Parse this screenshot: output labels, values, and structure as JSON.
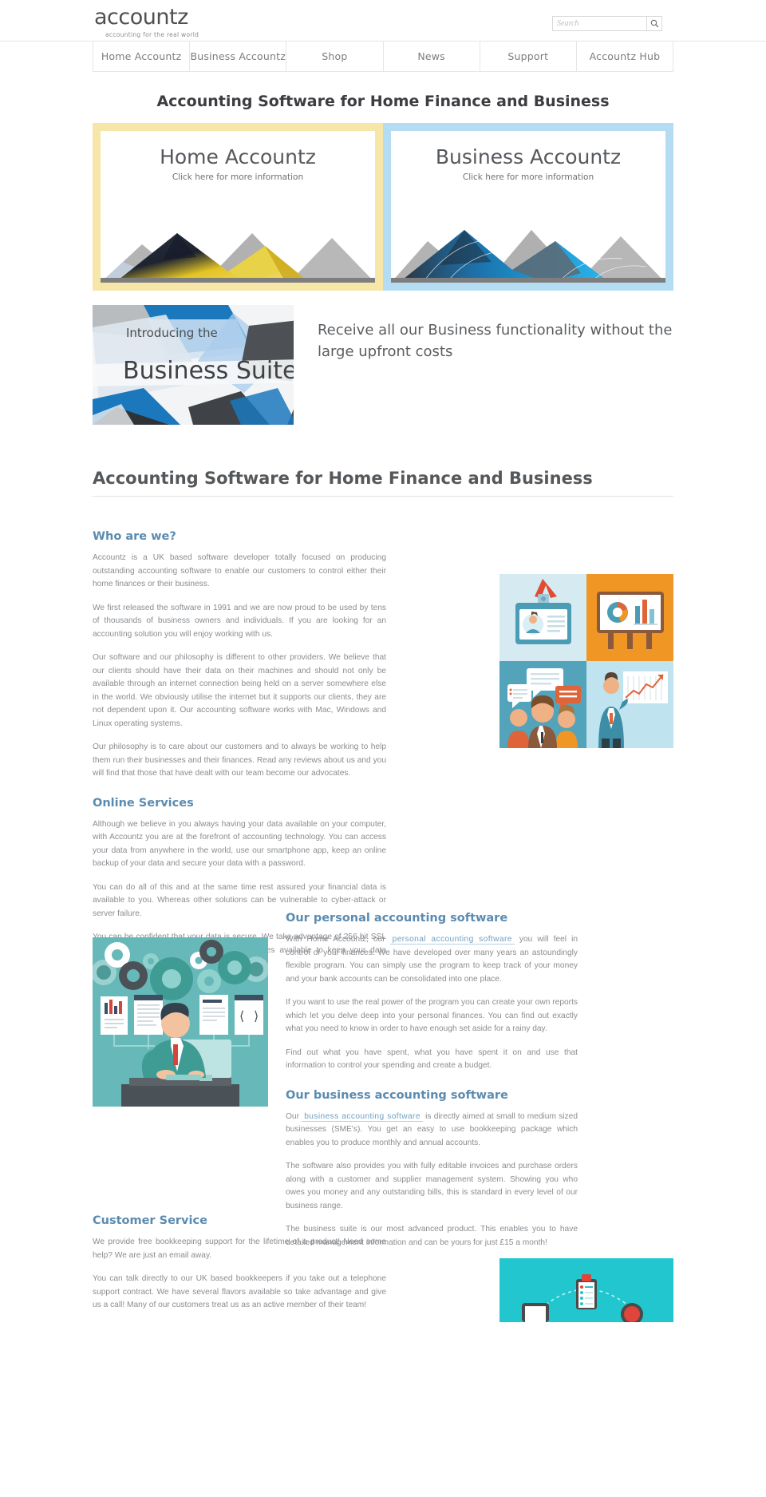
{
  "header": {
    "logo_word": "accountz",
    "logo_tagline": "accounting for the real world",
    "search": {
      "placeholder": "Search",
      "value": "",
      "button_icon": "search-icon"
    }
  },
  "nav": {
    "items": [
      {
        "label": "Home Accountz"
      },
      {
        "label": "Business Accountz"
      },
      {
        "label": "Shop"
      },
      {
        "label": "News"
      },
      {
        "label": "Support"
      },
      {
        "label": "Accountz Hub"
      }
    ]
  },
  "hero": {
    "title": "Accounting Software for Home Finance and Business"
  },
  "banners": [
    {
      "title": "Home Accountz",
      "subtitle": "Click here for more information",
      "frame_color": "#f6e6a8",
      "art": "yellow-mountains"
    },
    {
      "title": "Business Accountz",
      "subtitle": "Click here for more information",
      "frame_color": "#b4dcf2",
      "art": "blue-mountains"
    }
  ],
  "suite": {
    "intro": "Introducing the",
    "name": "Business Suite",
    "pitch": "Receive all our Business functionality without the large upfront costs"
  },
  "main_heading": "Accounting Software for Home Finance and Business",
  "sections": {
    "who_are_we": {
      "heading": "Who are we?",
      "paragraphs": [
        "Accountz is a UK based software developer totally focused on producing outstanding accounting software to enable our customers to control either their home finances or their business.",
        "We first released the software in 1991 and we are now proud to be used by tens of thousands of business owners and individuals. If you are looking for an accounting solution you will enjoy working with us.",
        "Our software and our philosophy is different to other providers. We believe that our clients should have their data on their machines and should not only be available through an internet connection being held on a server somewhere else in the world. We obviously utilise the internet but it supports our clients, they are not dependent upon it. Our accounting software works with Mac, Windows and Linux operating systems.",
        "Our philosophy is to care about our customers and to always be working to help them run their businesses and their finances. Read any reviews about us and you will find that those that have dealt with our team become our advocates."
      ]
    },
    "online_services": {
      "heading": "Online Services",
      "paragraphs": [
        "Although we believe in you always having your data available on your computer, with Accountz you are at the forefront of accounting technology. You can access your data from anywhere in the world, use our smartphone app, keep an online backup of your data and secure your data with a password.",
        "You can do all of this and at the same time rest assured your financial data is available to you. Whereas other solutions can be vulnerable to cyber-attack or server failure.",
        "You can be confident that your data is secure. We take advantage of 256 bit SSL encryption and use the best security measures available to keep your data protected."
      ]
    },
    "personal_software": {
      "heading": "Our personal accounting software",
      "p1_before": "With Home Accountz, our",
      "p1_link": "personal accounting software",
      "p1_after": "you will feel in control of your finances. We have developed over many years an astoundingly flexible program. You can simply use the program to keep track of your money and your bank accounts can be consolidated into one place.",
      "paragraphs": [
        "If you want to use the real power of the program you can create your own reports which let you delve deep into your personal finances. You can find out exactly what you need to know in order to have enough set aside for a rainy day.",
        "Find out what you have spent, what you have spent it on and use that information to control your spending and create a budget."
      ]
    },
    "business_software": {
      "heading": "Our business accounting software",
      "p1_before": "Our",
      "p1_link": "business accounting software",
      "p1_after": "is directly aimed at small to medium sized businesses (SME's). You get an easy to use bookkeeping package which enables you to produce monthly and annual accounts.",
      "paragraphs": [
        "The software also provides you with fully editable invoices and purchase orders along with a customer and supplier management system. Showing you who owes you money and any outstanding bills, this is standard in every level of our business range.",
        "The business suite is our most advanced product. This enables you to have detailed management information and can be yours for just £15 a month!"
      ]
    },
    "customer_service": {
      "heading": "Customer Service",
      "paragraphs": [
        "We provide free bookkeeping support for the lifetime of a product! Need some help? We are just an email away.",
        "You can talk directly to our UK based bookkeepers if you take out a telephone support contract. We have several flavors available so take advantage and give us a call! Many of our customers treat us as an active member of their team!"
      ]
    }
  },
  "images": {
    "teamwork": "business-teamwork-collage-illustration",
    "gears": "office-worker-gears-illustration",
    "support": "customer-support-network-illustration"
  },
  "colors": {
    "accent_heading": "#5b8bb0",
    "link": "#6fa0c2",
    "home_frame": "#f6e6a8",
    "business_frame": "#b4dcf2",
    "body_text": "#8a8d91"
  }
}
